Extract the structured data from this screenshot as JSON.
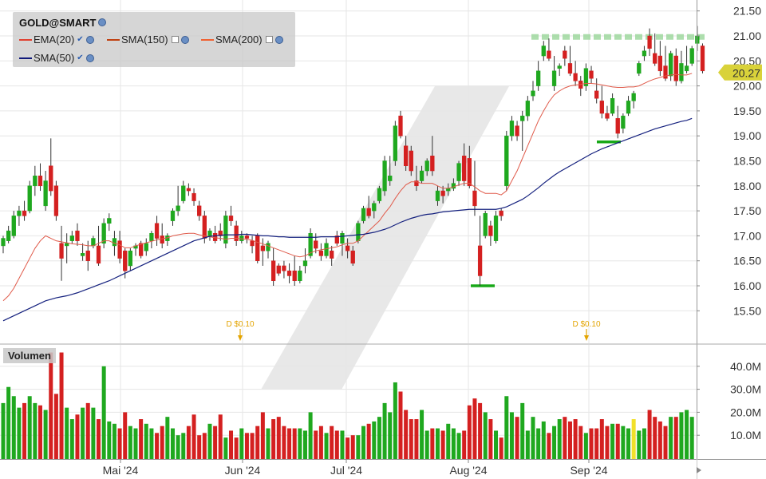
{
  "legend": {
    "symbol": "GOLD@SMART",
    "indicators": [
      {
        "label": "EMA(20)",
        "color": "#e04030"
      },
      {
        "label": "SMA(150)",
        "color": "#c04010"
      },
      {
        "label": "SMA(200)",
        "color": "#f06030"
      },
      {
        "label": "SMA(50)",
        "color": "#101a7a"
      }
    ]
  },
  "volume_label": "Volumen",
  "price_label": "20.27",
  "dividends": [
    "D $0.10",
    "D $0.10"
  ],
  "chart_data": {
    "type": "candlestick",
    "y_ticks": [
      "21.50",
      "21.00",
      "20.50",
      "20.00",
      "19.50",
      "19.00",
      "18.50",
      "18.00",
      "17.50",
      "17.00",
      "16.50",
      "16.00",
      "15.50"
    ],
    "ylim": [
      15.0,
      21.7
    ],
    "vol_ticks": [
      "40.0M",
      "30.0M",
      "20.0M",
      "10.0M"
    ],
    "x_ticks": [
      "Mai '24",
      "Jun '24",
      "Jul '24",
      "Aug '24",
      "Sep '24"
    ],
    "last_price": 20.27,
    "candles": [
      [
        16.8,
        17.0,
        16.65,
        16.95
      ],
      [
        16.9,
        17.2,
        16.85,
        17.1
      ],
      [
        17.0,
        17.5,
        16.95,
        17.4
      ],
      [
        17.4,
        17.6,
        17.2,
        17.5
      ],
      [
        17.5,
        17.7,
        17.3,
        17.4
      ],
      [
        17.5,
        18.1,
        17.45,
        18.0
      ],
      [
        18.0,
        18.4,
        17.8,
        18.2
      ],
      [
        18.2,
        18.45,
        17.9,
        18.0
      ],
      [
        17.6,
        18.3,
        17.5,
        18.1
      ],
      [
        18.4,
        18.95,
        17.8,
        17.9
      ],
      [
        18.0,
        18.1,
        17.3,
        17.4
      ],
      [
        16.85,
        17.2,
        16.1,
        16.55
      ],
      [
        16.8,
        17.05,
        16.45,
        16.85
      ],
      [
        16.9,
        17.1,
        16.85,
        17.0
      ],
      [
        17.1,
        17.25,
        16.8,
        16.9
      ],
      [
        16.6,
        16.85,
        16.5,
        16.65
      ],
      [
        16.7,
        16.9,
        16.3,
        16.5
      ],
      [
        16.8,
        17.0,
        16.75,
        16.95
      ],
      [
        16.8,
        17.2,
        16.4,
        16.45
      ],
      [
        16.85,
        17.35,
        16.75,
        17.25
      ],
      [
        17.25,
        17.45,
        17.1,
        17.35
      ],
      [
        16.8,
        17.1,
        16.6,
        16.95
      ],
      [
        16.9,
        17.1,
        16.45,
        16.55
      ],
      [
        16.7,
        16.75,
        16.15,
        16.3
      ],
      [
        16.4,
        16.75,
        16.3,
        16.7
      ],
      [
        16.75,
        16.85,
        16.6,
        16.8
      ],
      [
        16.85,
        16.9,
        16.55,
        16.6
      ],
      [
        16.7,
        16.95,
        16.6,
        16.85
      ],
      [
        16.9,
        17.1,
        16.75,
        17.05
      ],
      [
        17.25,
        17.4,
        16.8,
        16.95
      ],
      [
        17.0,
        17.25,
        16.75,
        16.85
      ],
      [
        16.9,
        17.05,
        16.8,
        17.0
      ],
      [
        17.3,
        17.55,
        17.2,
        17.5
      ],
      [
        17.5,
        18.0,
        17.4,
        17.6
      ],
      [
        17.7,
        18.1,
        17.65,
        18.0
      ],
      [
        17.95,
        18.05,
        17.8,
        17.9
      ],
      [
        17.85,
        17.95,
        17.6,
        17.7
      ],
      [
        17.6,
        17.7,
        17.3,
        17.4
      ],
      [
        17.4,
        17.5,
        16.85,
        16.95
      ],
      [
        17.0,
        17.15,
        16.9,
        17.1
      ],
      [
        17.05,
        17.2,
        16.85,
        16.9
      ],
      [
        17.1,
        17.25,
        16.9,
        17.0
      ],
      [
        16.85,
        17.5,
        16.75,
        17.4
      ],
      [
        17.4,
        17.6,
        17.2,
        17.3
      ],
      [
        17.2,
        17.3,
        16.8,
        16.9
      ],
      [
        16.9,
        17.1,
        16.85,
        17.0
      ],
      [
        17.0,
        17.05,
        16.85,
        16.95
      ],
      [
        16.9,
        17.0,
        16.65,
        16.8
      ],
      [
        17.0,
        17.05,
        16.45,
        16.5
      ],
      [
        16.8,
        16.95,
        16.4,
        16.7
      ],
      [
        16.7,
        16.9,
        16.55,
        16.85
      ],
      [
        16.5,
        16.75,
        16.0,
        16.1
      ],
      [
        16.4,
        16.45,
        16.2,
        16.25
      ],
      [
        16.4,
        16.5,
        16.15,
        16.3
      ],
      [
        16.3,
        16.45,
        16.05,
        16.2
      ],
      [
        16.3,
        16.6,
        16.0,
        16.1
      ],
      [
        16.1,
        16.4,
        16.05,
        16.3
      ],
      [
        16.4,
        16.75,
        16.25,
        16.5
      ],
      [
        16.6,
        17.15,
        16.55,
        17.05
      ],
      [
        16.9,
        17.05,
        16.65,
        16.75
      ],
      [
        16.7,
        16.85,
        16.5,
        16.6
      ],
      [
        16.6,
        16.95,
        16.55,
        16.85
      ],
      [
        16.7,
        16.8,
        16.4,
        16.55
      ],
      [
        17.0,
        17.1,
        16.8,
        16.85
      ],
      [
        16.85,
        17.1,
        16.6,
        17.05
      ],
      [
        16.8,
        16.95,
        16.55,
        16.7
      ],
      [
        16.7,
        16.8,
        16.4,
        16.45
      ],
      [
        16.9,
        17.3,
        16.85,
        17.25
      ],
      [
        17.3,
        17.6,
        17.25,
        17.55
      ],
      [
        17.55,
        17.8,
        17.35,
        17.4
      ],
      [
        17.5,
        17.7,
        17.35,
        17.65
      ],
      [
        17.7,
        18.0,
        17.65,
        17.95
      ],
      [
        17.9,
        18.6,
        17.8,
        18.5
      ],
      [
        18.1,
        18.6,
        18.0,
        18.2
      ],
      [
        18.5,
        19.3,
        18.4,
        19.2
      ],
      [
        19.4,
        19.5,
        18.95,
        19.0
      ],
      [
        18.8,
        19.0,
        18.3,
        18.4
      ],
      [
        18.7,
        18.8,
        18.2,
        18.3
      ],
      [
        18.1,
        18.4,
        17.9,
        18.0
      ],
      [
        18.1,
        18.4,
        18.05,
        18.3
      ],
      [
        18.3,
        18.55,
        18.2,
        18.5
      ],
      [
        18.6,
        19.0,
        18.2,
        18.3
      ],
      [
        17.7,
        18.0,
        17.6,
        17.9
      ],
      [
        17.9,
        18.0,
        17.65,
        17.8
      ],
      [
        17.9,
        18.05,
        17.8,
        17.95
      ],
      [
        17.95,
        18.15,
        17.9,
        18.05
      ],
      [
        18.1,
        18.5,
        18.0,
        18.45
      ],
      [
        18.6,
        18.85,
        18.0,
        18.1
      ],
      [
        18.55,
        18.8,
        17.95,
        18.0
      ],
      [
        17.9,
        18.5,
        17.4,
        17.6
      ],
      [
        16.8,
        17.4,
        16.0,
        16.2
      ],
      [
        17.0,
        17.5,
        16.95,
        17.45
      ],
      [
        17.2,
        17.3,
        16.8,
        17.0
      ],
      [
        16.9,
        17.5,
        16.85,
        17.4
      ],
      [
        17.5,
        17.55,
        17.3,
        17.4
      ],
      [
        18.0,
        19.1,
        17.9,
        19.0
      ],
      [
        19.0,
        19.4,
        18.9,
        19.3
      ],
      [
        19.2,
        19.3,
        18.9,
        19.0
      ],
      [
        19.3,
        19.5,
        18.7,
        19.4
      ],
      [
        19.4,
        19.8,
        19.3,
        19.7
      ],
      [
        19.8,
        20.1,
        19.7,
        19.9
      ],
      [
        20.0,
        20.5,
        19.9,
        20.3
      ],
      [
        20.6,
        20.9,
        20.5,
        20.8
      ],
      [
        20.7,
        20.95,
        20.5,
        20.55
      ],
      [
        20.0,
        20.6,
        19.9,
        20.3
      ],
      [
        20.35,
        20.45,
        20.2,
        20.4
      ],
      [
        20.7,
        20.8,
        20.4,
        20.55
      ],
      [
        20.45,
        20.8,
        20.2,
        20.25
      ],
      [
        20.25,
        20.5,
        20.0,
        20.1
      ],
      [
        20.1,
        20.2,
        19.8,
        19.95
      ],
      [
        20.0,
        20.45,
        19.9,
        20.35
      ],
      [
        20.3,
        20.4,
        20.05,
        20.15
      ],
      [
        19.9,
        20.15,
        19.65,
        19.75
      ],
      [
        19.7,
        20.0,
        19.35,
        19.45
      ],
      [
        19.45,
        19.6,
        19.3,
        19.35
      ],
      [
        19.45,
        19.85,
        19.4,
        19.75
      ],
      [
        19.35,
        19.6,
        18.95,
        19.05
      ],
      [
        19.15,
        19.45,
        19.05,
        19.4
      ],
      [
        19.45,
        19.8,
        19.4,
        19.7
      ],
      [
        19.7,
        19.9,
        19.55,
        19.85
      ],
      [
        20.25,
        20.5,
        20.2,
        20.45
      ],
      [
        20.6,
        20.8,
        20.5,
        20.7
      ],
      [
        21.0,
        21.15,
        20.6,
        20.75
      ],
      [
        20.65,
        21.05,
        20.4,
        20.45
      ],
      [
        20.6,
        20.9,
        20.2,
        20.3
      ],
      [
        20.4,
        20.8,
        20.1,
        20.15
      ],
      [
        20.2,
        20.7,
        20.1,
        20.65
      ],
      [
        20.6,
        20.75,
        20.0,
        20.1
      ],
      [
        20.1,
        20.7,
        20.05,
        20.45
      ],
      [
        20.3,
        20.8,
        20.25,
        20.4
      ],
      [
        20.45,
        20.8,
        20.4,
        20.75
      ],
      [
        20.85,
        21.2,
        20.7,
        21.0
      ],
      [
        20.8,
        20.85,
        20.25,
        20.3
      ]
    ],
    "volumes_m": [
      24,
      31,
      27,
      22,
      24,
      27,
      24,
      23,
      21,
      46,
      28,
      46,
      22,
      17,
      19,
      22,
      24,
      22,
      17,
      40,
      16,
      15,
      13,
      20,
      14,
      13,
      17,
      15,
      13,
      11,
      14,
      18,
      13,
      10,
      11,
      14,
      19,
      10,
      11,
      15,
      14,
      19,
      9,
      12,
      9,
      13,
      11,
      11,
      14,
      20,
      13,
      17,
      18,
      14,
      13,
      13,
      13,
      12,
      20,
      12,
      14,
      11,
      14,
      12,
      12,
      9,
      10,
      10,
      14,
      15,
      16,
      18,
      24,
      20,
      33,
      29,
      21,
      17,
      17,
      21,
      12,
      13,
      13,
      12,
      15,
      13,
      11,
      12,
      23,
      26,
      24,
      20,
      17,
      12,
      9,
      27,
      20,
      18,
      24,
      12,
      18,
      13,
      16,
      11,
      14,
      17,
      18,
      16,
      17,
      14,
      11,
      13,
      13,
      17,
      14,
      15,
      15,
      14,
      13,
      17,
      12,
      13,
      21,
      18,
      16,
      14,
      18,
      18,
      20,
      21,
      18
    ],
    "ema20": [
      15.7,
      15.8,
      15.95,
      16.15,
      16.35,
      16.55,
      16.75,
      16.9,
      17.0,
      16.95,
      16.9,
      16.88,
      16.86,
      16.84,
      16.83,
      16.82,
      16.8,
      16.8,
      16.85,
      16.9,
      16.9,
      16.85,
      16.82,
      16.76,
      16.76,
      16.8,
      16.83,
      16.86,
      16.89,
      16.92,
      16.94,
      16.96,
      17.0,
      17.02,
      17.04,
      17.05,
      17.05,
      17.02,
      17.0,
      16.98,
      16.96,
      16.95,
      16.93,
      16.95,
      16.95,
      16.94,
      16.93,
      16.91,
      16.87,
      16.84,
      16.8,
      16.76,
      16.72,
      16.68,
      16.64,
      16.6,
      16.58,
      16.6,
      16.66,
      16.7,
      16.72,
      16.74,
      16.76,
      16.78,
      16.82,
      16.85,
      16.85,
      16.9,
      17.0,
      17.1,
      17.2,
      17.3,
      17.45,
      17.58,
      17.75,
      17.9,
      18.02,
      18.08,
      18.08,
      18.05,
      18.05,
      18.05,
      18.0,
      17.95,
      17.95,
      17.98,
      18.02,
      18.05,
      18.05,
      17.98,
      17.9,
      17.85,
      17.85,
      17.85,
      17.82,
      17.9,
      18.1,
      18.3,
      18.55,
      18.8,
      19.05,
      19.3,
      19.5,
      19.68,
      19.82,
      19.9,
      19.96,
      20.0,
      20.02,
      20.03,
      20.05,
      20.05,
      20.04,
      20.02,
      20.0,
      19.98,
      19.97,
      19.97,
      19.98,
      19.98,
      20.0,
      20.05,
      20.1,
      20.14,
      20.17,
      20.2,
      20.22,
      20.23,
      20.22,
      20.22,
      20.25
    ],
    "sma50": [
      15.3,
      15.35,
      15.4,
      15.45,
      15.5,
      15.55,
      15.6,
      15.65,
      15.7,
      15.73,
      15.76,
      15.78,
      15.8,
      15.83,
      15.86,
      15.9,
      15.94,
      15.98,
      16.02,
      16.06,
      16.1,
      16.15,
      16.2,
      16.25,
      16.3,
      16.35,
      16.4,
      16.45,
      16.5,
      16.55,
      16.6,
      16.65,
      16.7,
      16.75,
      16.8,
      16.85,
      16.9,
      16.93,
      16.96,
      16.99,
      17.0,
      17.01,
      17.02,
      17.02,
      17.02,
      17.03,
      17.03,
      17.02,
      17.01,
      17.0,
      17.0,
      16.99,
      16.98,
      16.98,
      16.97,
      16.97,
      16.97,
      16.97,
      16.97,
      16.97,
      16.98,
      16.98,
      16.98,
      16.98,
      16.99,
      17.0,
      17.01,
      17.02,
      17.03,
      17.05,
      17.07,
      17.1,
      17.13,
      17.17,
      17.22,
      17.27,
      17.31,
      17.35,
      17.38,
      17.41,
      17.43,
      17.44,
      17.46,
      17.48,
      17.49,
      17.5,
      17.51,
      17.52,
      17.53,
      17.53,
      17.53,
      17.53,
      17.53,
      17.53,
      17.55,
      17.58,
      17.63,
      17.68,
      17.73,
      17.8,
      17.88,
      17.96,
      18.05,
      18.13,
      18.21,
      18.28,
      18.34,
      18.4,
      18.46,
      18.52,
      18.58,
      18.64,
      18.69,
      18.74,
      18.78,
      18.82,
      18.86,
      18.9,
      18.94,
      18.98,
      19.02,
      19.06,
      19.1,
      19.14,
      19.17,
      19.2,
      19.23,
      19.26,
      19.29,
      19.31,
      19.35
    ]
  }
}
